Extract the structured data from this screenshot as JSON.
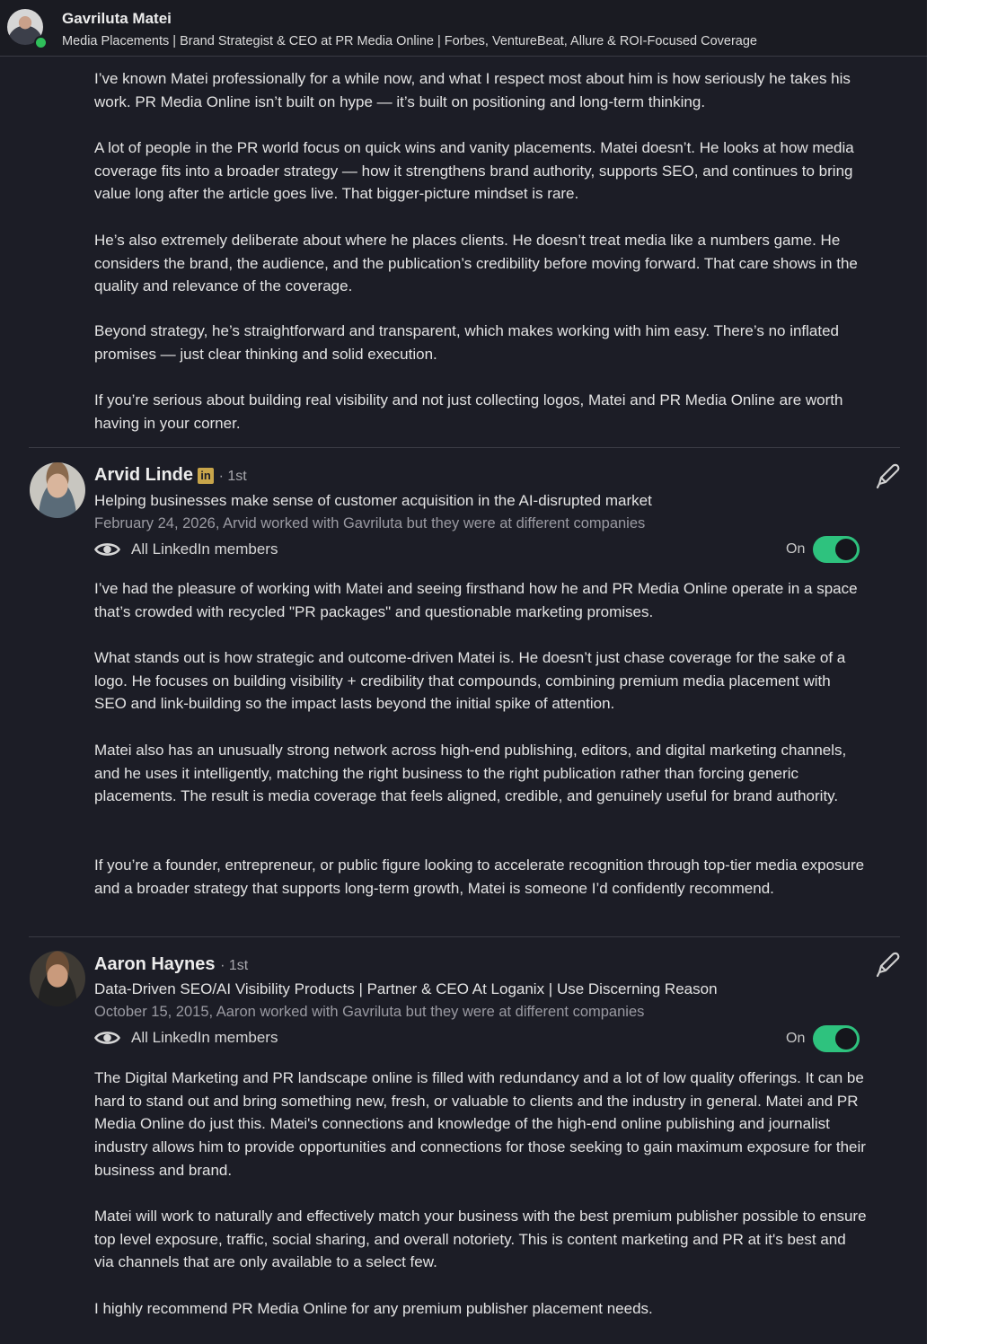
{
  "header": {
    "name": "Gavriluta Matei",
    "headline": "Media Placements | Brand Strategist & CEO at PR Media Online | Forbes, VentureBeat, Allure & ROI-Focused Coverage"
  },
  "top_recommendation": {
    "paragraphs": [
      "I’ve known Matei professionally for a while now, and what I respect most about him is how seriously he takes his work. PR Media Online isn’t built on hype — it’s built on positioning and long-term thinking.",
      "A lot of people in the PR world focus on quick wins and vanity placements. Matei doesn’t. He looks at how media coverage fits into a broader strategy — how it strengthens brand authority, supports SEO, and continues to bring value long after the article goes live. That bigger-picture mindset is rare.",
      "He’s also extremely deliberate about where he places clients. He doesn’t treat media like a numbers game. He considers the brand, the audience, and the publication’s credibility before moving forward. That care shows in the quality and relevance of the coverage.",
      "Beyond strategy, he’s straightforward and transparent, which makes working with him easy. There’s no inflated promises — just clear thinking and solid execution.",
      "If you’re serious about building real visibility and not just collecting logos, Matei and PR Media Online are worth having in your corner."
    ]
  },
  "recommendations": [
    {
      "name": "Arvid Linde",
      "badge": "in",
      "degree": "· 1st",
      "headline": "Helping businesses make sense of customer acquisition in the AI-disrupted market",
      "meta": "February 24, 2026, Arvid worked with Gavriluta but they were at different companies",
      "visibility": "All LinkedIn members",
      "toggle_label": "On",
      "toggle_on": true,
      "paragraphs": [
        "I’ve had the pleasure of working with Matei and seeing firsthand how he and PR Media Online operate in a space that’s crowded with recycled \"PR packages\" and questionable marketing promises.",
        "What stands out is how strategic and outcome-driven Matei is. He doesn’t just chase coverage for the sake of a logo. He focuses on building visibility + credibility that compounds, combining premium media placement with SEO and link-building so the impact lasts beyond the initial spike of attention.",
        "Matei also has an unusually strong network across high-end publishing, editors, and digital marketing channels, and he uses it intelligently, matching the right business to the right publication rather than forcing generic placements. The result is media coverage that feels aligned, credible, and genuinely useful for brand authority.",
        "If you’re a founder, entrepreneur, or public figure looking to accelerate recognition through top-tier media exposure and a broader strategy that supports long-term growth, Matei is someone I’d confidently recommend."
      ]
    },
    {
      "name": "Aaron Haynes",
      "degree": "· 1st",
      "headline": "Data-Driven SEO/AI Visibility Products | Partner & CEO At Loganix | Use Discerning Reason",
      "meta": "October 15, 2015, Aaron worked with Gavriluta but they were at different companies",
      "visibility": "All LinkedIn members",
      "toggle_label": "On",
      "toggle_on": true,
      "paragraphs": [
        "The Digital Marketing and PR landscape online is filled with redundancy and a lot of low quality offerings. It can be hard to stand out and bring something new, fresh, or valuable to clients and the industry in general. Matei and PR Media Online do just this. Matei's connections and knowledge of the high-end online publishing and journalist industry allows him to provide opportunities and connections for those seeking to gain maximum exposure for their business and brand.",
        "Matei will work to naturally and effectively match your business with the best premium publisher possible to ensure top level exposure, traffic, social sharing, and overall notoriety. This is content marketing and PR at it's best and via channels that are only available to a select few.",
        "I highly recommend PR Media Online for any premium publisher placement needs."
      ]
    }
  ],
  "colors": {
    "panel_bg": "#1c1d26",
    "toggle_on": "#2ec27e",
    "presence": "#2fbf5a",
    "premium_badge": "#c8a54a"
  },
  "icons": [
    "eye-icon",
    "pencil-icon",
    "linkedin-premium-icon"
  ]
}
